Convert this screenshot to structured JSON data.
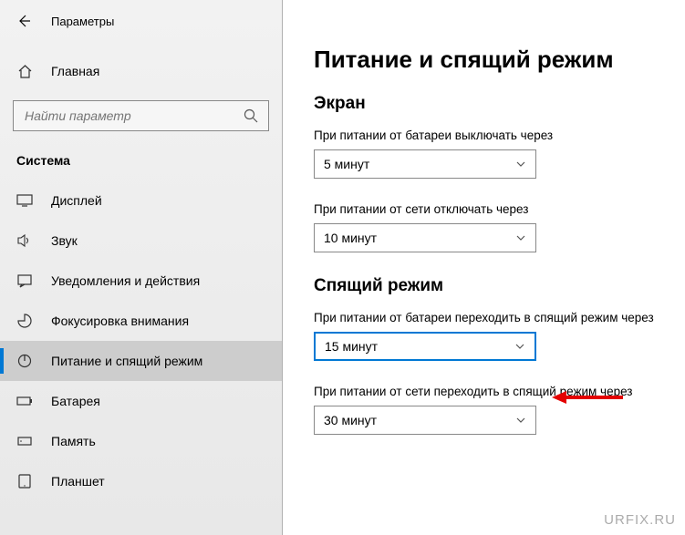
{
  "header": {
    "title": "Параметры"
  },
  "home": {
    "label": "Главная"
  },
  "search": {
    "placeholder": "Найти параметр"
  },
  "section": {
    "label": "Система"
  },
  "nav": {
    "items": [
      {
        "label": "Дисплей"
      },
      {
        "label": "Звук"
      },
      {
        "label": "Уведомления и действия"
      },
      {
        "label": "Фокусировка внимания"
      },
      {
        "label": "Питание и спящий режим"
      },
      {
        "label": "Батарея"
      },
      {
        "label": "Память"
      },
      {
        "label": "Планшет"
      }
    ]
  },
  "main": {
    "heading": "Питание и спящий режим",
    "screen": {
      "title": "Экран",
      "battery_label": "При питании от батареи выключать через",
      "battery_value": "5 минут",
      "plugged_label": "При питании от сети отключать через",
      "plugged_value": "10 минут"
    },
    "sleep": {
      "title": "Спящий режим",
      "battery_label": "При питании от батареи переходить в спящий режим через",
      "battery_value": "15 минут",
      "plugged_label": "При питании от сети переходить в спящий режим через",
      "plugged_value": "30 минут"
    }
  },
  "watermark": "URFIX.RU"
}
